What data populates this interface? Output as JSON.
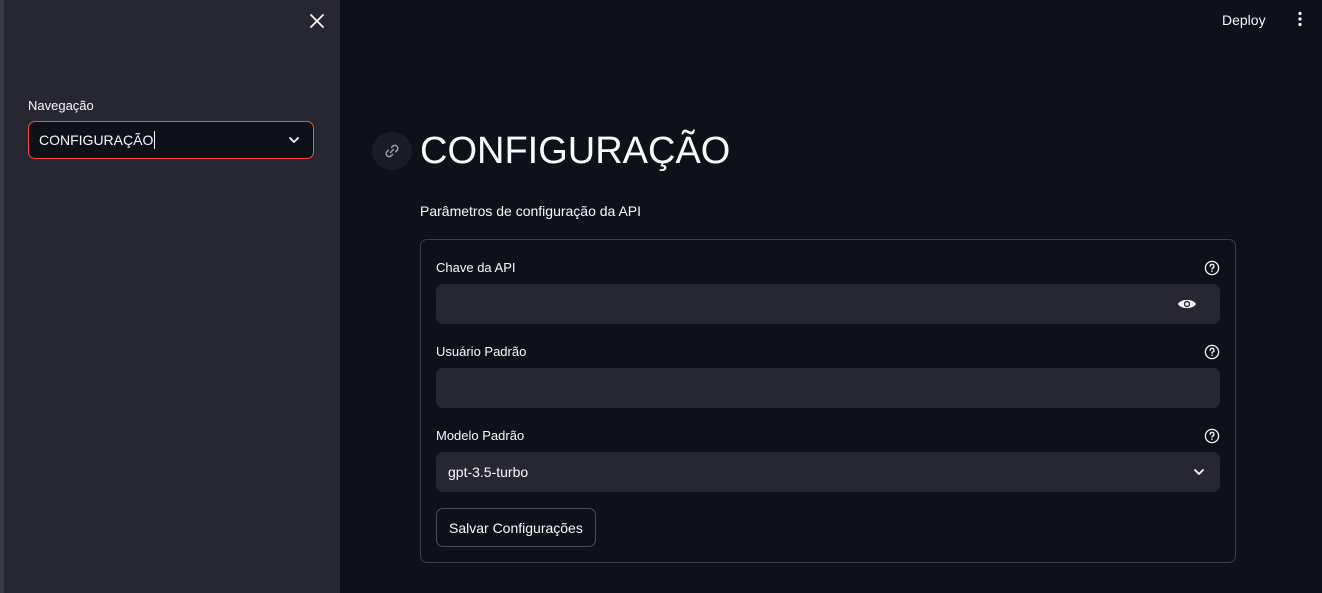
{
  "sidebar": {
    "nav_label": "Navegação",
    "nav_selected": "CONFIGURAÇÃO",
    "close_icon": "close-icon",
    "select_icon": "chevron-down-icon"
  },
  "topbar": {
    "deploy_label": "Deploy",
    "menu_icon": "more-vertical-icon"
  },
  "main": {
    "anchor_icon": "link-icon",
    "title": "CONFIGURAÇÃO",
    "subtitle": "Parâmetros de configuração da API",
    "form": {
      "api_key": {
        "label": "Chave da API",
        "value": "",
        "help_icon": "help-circle-icon",
        "toggle_icon": "eye-icon"
      },
      "default_user": {
        "label": "Usuário Padrão",
        "value": "",
        "help_icon": "help-circle-icon"
      },
      "default_model": {
        "label": "Modelo Padrão",
        "value": "gpt-3.5-turbo",
        "help_icon": "help-circle-icon",
        "select_icon": "chevron-down-icon"
      },
      "save_label": "Salvar Configurações"
    }
  },
  "colors": {
    "background": "#0e1117",
    "sidebar": "#262730",
    "accent": "#ff4b4b",
    "input_bg": "#262730",
    "border": "#3d3f4a"
  }
}
